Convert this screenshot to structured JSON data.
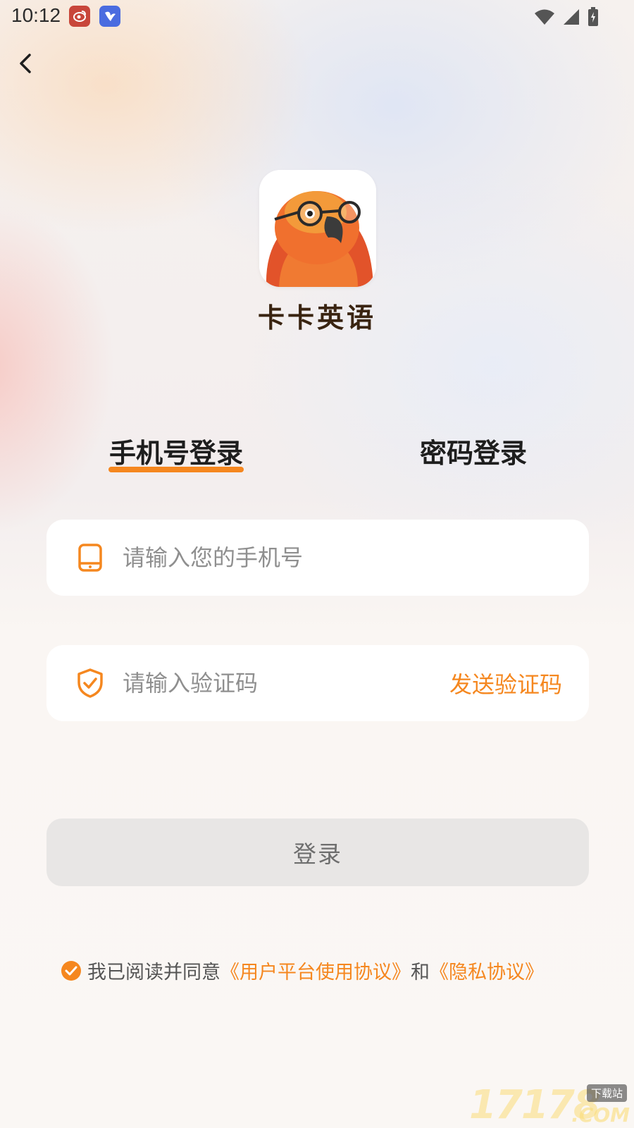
{
  "status_bar": {
    "time": "10:12",
    "icons": [
      "weibo-notification-icon",
      "bird-app-notification-icon",
      "wifi-icon",
      "signal-icon",
      "battery-charging-icon"
    ]
  },
  "header": {
    "back_icon": "chevron-left-icon"
  },
  "app": {
    "name": "卡卡英语",
    "logo": "parrot-with-glasses-logo"
  },
  "tabs": [
    {
      "label": "手机号登录",
      "active": true
    },
    {
      "label": "密码登录",
      "active": false
    }
  ],
  "form": {
    "phone": {
      "placeholder": "请输入您的手机号",
      "icon": "phone-icon",
      "value": ""
    },
    "code": {
      "placeholder": "请输入验证码",
      "icon": "shield-check-icon",
      "value": "",
      "send_label": "发送验证码"
    },
    "login_label": "登录"
  },
  "agreement": {
    "checked": true,
    "prefix": "我已阅读并同意",
    "terms_link": "《用户平台使用协议》",
    "and": "和",
    "privacy_link": "《隐私协议》"
  },
  "watermark": {
    "number": "17178",
    "tag": "下载站",
    "suffix": ".COM"
  },
  "colors": {
    "accent": "#f5871f",
    "button_disabled": "#e8e6e5"
  }
}
